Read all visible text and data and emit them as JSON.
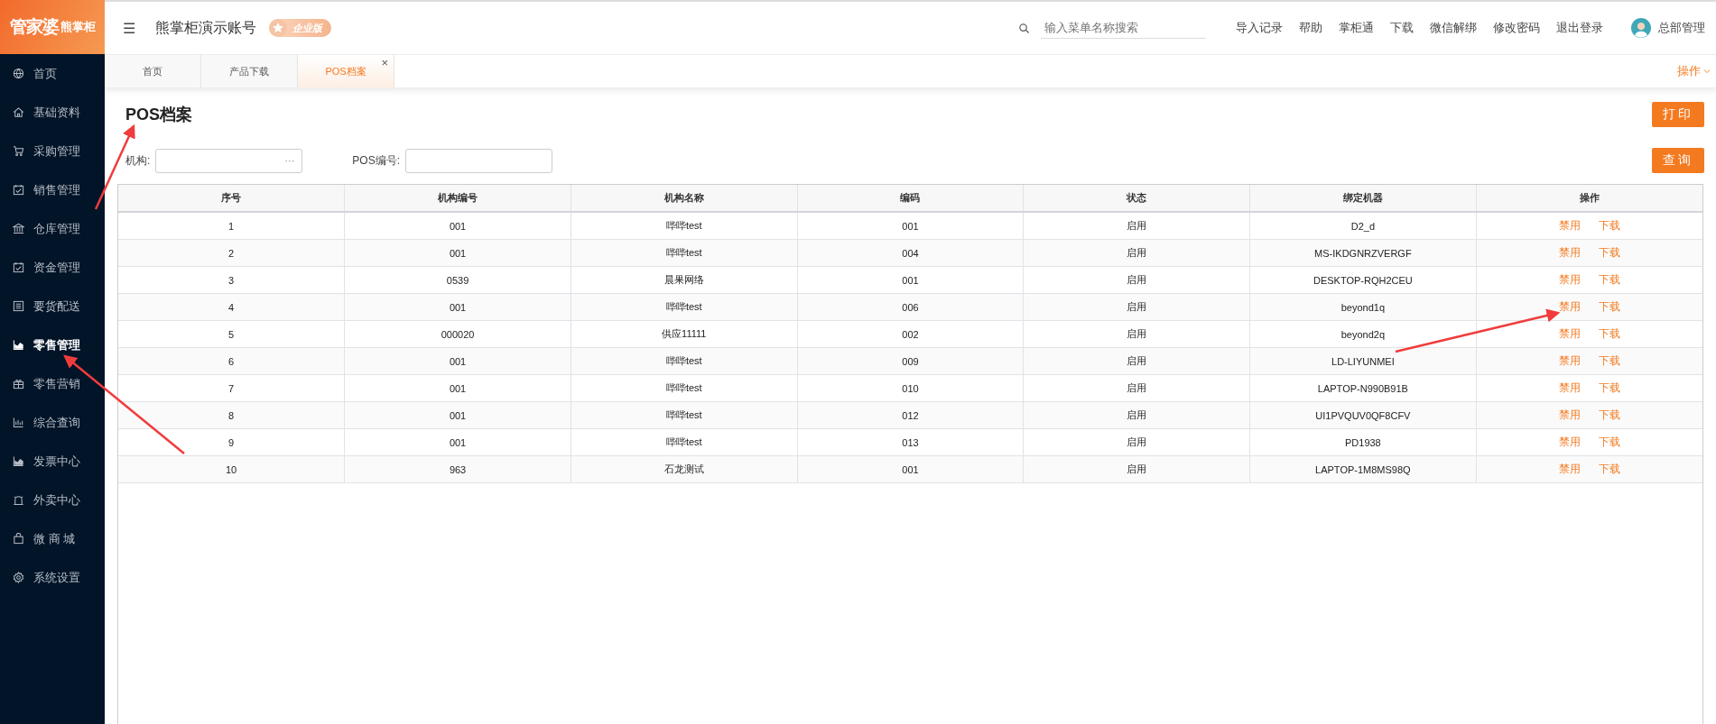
{
  "logo": {
    "brand": "管家婆",
    "product": "熊掌柜"
  },
  "sidebar": {
    "items": [
      {
        "label": "首页",
        "selected": false
      },
      {
        "label": "基础资料",
        "selected": false
      },
      {
        "label": "采购管理",
        "selected": false
      },
      {
        "label": "销售管理",
        "selected": false
      },
      {
        "label": "仓库管理",
        "selected": false
      },
      {
        "label": "资金管理",
        "selected": false
      },
      {
        "label": "要货配送",
        "selected": false
      },
      {
        "label": "零售管理",
        "selected": true
      },
      {
        "label": "零售营销",
        "selected": false
      },
      {
        "label": "综合查询",
        "selected": false
      },
      {
        "label": "发票中心",
        "selected": false
      },
      {
        "label": "外卖中心",
        "selected": false
      },
      {
        "label": "微 商 城",
        "selected": false
      },
      {
        "label": "系统设置",
        "selected": false
      }
    ]
  },
  "header": {
    "menu_toggle": "☰",
    "account": "熊掌柜演示账号",
    "edition_badge": "企业版",
    "search": {
      "placeholder": "输入菜单名称搜索"
    },
    "links": [
      "导入记录",
      "帮助",
      "掌柜通",
      "下载",
      "微信解绑",
      "修改密码",
      "退出登录"
    ],
    "user": "总部管理"
  },
  "tabs": [
    {
      "label": "首页",
      "selected": false,
      "closable": false
    },
    {
      "label": "产品下载",
      "selected": false,
      "closable": false
    },
    {
      "label": "POS档案",
      "selected": true,
      "closable": true
    }
  ],
  "tab_close": "×",
  "operations_menu": "操作",
  "page": {
    "title": "POS档案",
    "print_button": "打印",
    "query_button": "查询",
    "filters": [
      {
        "label": "机构:",
        "kind": "picker",
        "picker_glyph": "···"
      },
      {
        "label": "POS编号:",
        "kind": "text"
      }
    ]
  },
  "table": {
    "columns": [
      "序号",
      "机构编号",
      "机构名称",
      "编码",
      "状态",
      "绑定机器",
      "操作"
    ],
    "rows": [
      {
        "cells": [
          "1",
          "001",
          "哔哔test",
          "001",
          "启用",
          "D2_d"
        ],
        "actions": [
          "禁用",
          "下载"
        ]
      },
      {
        "cells": [
          "2",
          "001",
          "哔哔test",
          "004",
          "启用",
          "MS-IKDGNRZVERGF"
        ],
        "actions": [
          "禁用",
          "下载"
        ]
      },
      {
        "cells": [
          "3",
          "0539",
          "晨果网络",
          "001",
          "启用",
          "DESKTOP-RQH2CEU"
        ],
        "actions": [
          "禁用",
          "下载"
        ]
      },
      {
        "cells": [
          "4",
          "001",
          "哔哔test",
          "006",
          "启用",
          "beyond1q"
        ],
        "actions": [
          "禁用",
          "下载"
        ]
      },
      {
        "cells": [
          "5",
          "000020",
          "供应11111",
          "002",
          "启用",
          "beyond2q"
        ],
        "actions": [
          "禁用",
          "下载"
        ]
      },
      {
        "cells": [
          "6",
          "001",
          "哔哔test",
          "009",
          "启用",
          "LD-LIYUNMEI"
        ],
        "actions": [
          "禁用",
          "下载"
        ]
      },
      {
        "cells": [
          "7",
          "001",
          "哔哔test",
          "010",
          "启用",
          "LAPTOP-N990B91B"
        ],
        "actions": [
          "禁用",
          "下载"
        ]
      },
      {
        "cells": [
          "8",
          "001",
          "哔哔test",
          "012",
          "启用",
          "UI1PVQUV0QF8CFV"
        ],
        "actions": [
          "禁用",
          "下载"
        ]
      },
      {
        "cells": [
          "9",
          "001",
          "哔哔test",
          "013",
          "启用",
          "PD1938"
        ],
        "actions": [
          "禁用",
          "下载"
        ]
      },
      {
        "cells": [
          "10",
          "963",
          "石龙测试",
          "001",
          "启用",
          "LAPTOP-1M8MS98Q"
        ],
        "actions": [
          "禁用",
          "下载"
        ]
      }
    ]
  }
}
